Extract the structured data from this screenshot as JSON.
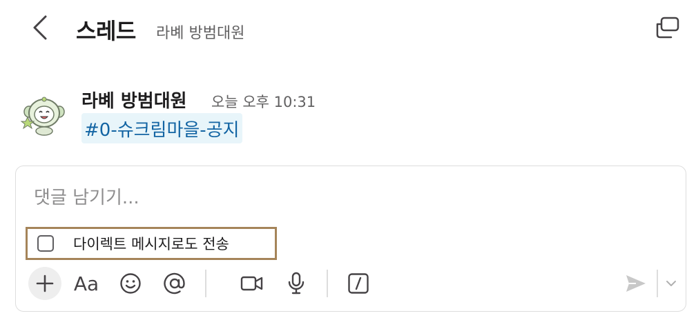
{
  "header": {
    "title": "스레드",
    "subtitle": "라볘 방범대원",
    "back_icon": "chevron-left-icon",
    "expand_icon": "open-in-window-icon"
  },
  "message": {
    "author": "라볘 방범대원",
    "timestamp": "오늘 오후 10:31",
    "channel_link": "#0-슈크림마을-공지",
    "avatar_icon": "robot-avatar-icon"
  },
  "composer": {
    "placeholder": "댓글 남기기...",
    "value": "",
    "dm_option_label": "다이렉트 메시지로도 전송",
    "dm_option_checked": false,
    "toolbar": {
      "add": "plus-icon",
      "format_label": "Aa",
      "emoji": "emoji-icon",
      "mention": "at-sign-icon",
      "video": "video-camera-icon",
      "audio": "microphone-icon",
      "shortcut": "slash-command-icon",
      "send": "send-icon",
      "send_options": "chevron-down-icon"
    }
  },
  "colors": {
    "accent_link": "#1264a3",
    "link_bg": "#e8f5fa",
    "highlight_border": "#a58459",
    "muted_text": "#616061"
  }
}
